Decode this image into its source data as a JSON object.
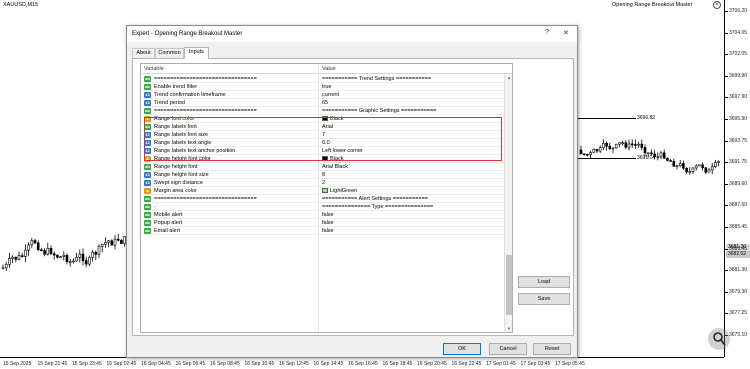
{
  "chart": {
    "symbol": "XAUUSD,M15",
    "indicator_title": "Opening Range Breakout Master",
    "price_labels": [
      "3706.20",
      "3704.05",
      "3702.05",
      "3699.90",
      "3697.90",
      "3695.90",
      "3693.75",
      "3691.75",
      "3689.60",
      "3687.60",
      "3685.45",
      "3683.45",
      "3681.30",
      "3679.30",
      "3677.25",
      "3675.10"
    ],
    "current_price": "3682.52",
    "alt_price": "3681.30",
    "level_1": "3696.82",
    "level_2": "3691.14",
    "time_labels": [
      "15 Sep 2025",
      "15 Sep 21:45",
      "15 Sep 23:45",
      "16 Sep 02:45",
      "16 Sep 04:45",
      "16 Sep 06:45",
      "16 Sep 08:45",
      "16 Sep 10:45",
      "16 Sep 12:45",
      "16 Sep 14:45",
      "16 Sep 16:45",
      "16 Sep 18:45",
      "16 Sep 20:45",
      "16 Sep 22:45",
      "17 Sep 01:45",
      "17 Sep 03:45",
      "17 Sep 05:45"
    ]
  },
  "dialog": {
    "title": "Expert - Opening Range Breakout Master",
    "help_label": "?",
    "close_label": "✕",
    "tabs": [
      {
        "label": "About"
      },
      {
        "label": "Common"
      },
      {
        "label": "Inputs"
      }
    ],
    "columns": {
      "variable": "Variable",
      "value": "Value"
    },
    "rows": [
      {
        "icon": "ab",
        "name": "================================",
        "value": "=========== Trend Settings ==========="
      },
      {
        "icon": "ab",
        "name": "Enable trend filter",
        "value": "true"
      },
      {
        "icon": "num",
        "name": "Trend confirmation timeframe",
        "value": "current"
      },
      {
        "icon": "num",
        "name": "Trend period",
        "value": "65"
      },
      {
        "icon": "ab",
        "name": "================================",
        "value": "=========== Graphic Settings ==========="
      },
      {
        "icon": "col",
        "name": "Range font color",
        "value": "Black"
      },
      {
        "icon": "ab",
        "name": "Range labels font",
        "value": "Arial"
      },
      {
        "icon": "num",
        "name": "Range labels font size",
        "value": "7"
      },
      {
        "icon": "num",
        "name": "Range labels text angle",
        "value": "0.0"
      },
      {
        "icon": "num",
        "name": "Range labels text anchor position",
        "value": "Left lower corner"
      },
      {
        "icon": "col",
        "name": "Range height font color",
        "value": "Black"
      },
      {
        "icon": "ab",
        "name": "Range height font",
        "value": "Arial Black"
      },
      {
        "icon": "num",
        "name": "Range height font size",
        "value": "8"
      },
      {
        "icon": "num",
        "name": "Swept sign distance",
        "value": "2"
      },
      {
        "icon": "col",
        "name": "Margin area color",
        "value": "LightGreen"
      },
      {
        "icon": "ab",
        "name": "================================",
        "value": "=========== Alert Settings ==========="
      },
      {
        "icon": "ab",
        "name": "-",
        "value": "=============== Type ==============="
      },
      {
        "icon": "ab",
        "name": "Mobile alert",
        "value": "false"
      },
      {
        "icon": "ab",
        "name": "Popup alert",
        "value": "false"
      },
      {
        "icon": "ab",
        "name": "Email alert",
        "value": "false"
      }
    ],
    "colors": {
      "Black": "#000000",
      "LightGreen": "#90ee90"
    },
    "buttons": {
      "load": "Load",
      "save": "Save",
      "ok": "OK",
      "cancel": "Cancel",
      "reset": "Reset"
    }
  }
}
